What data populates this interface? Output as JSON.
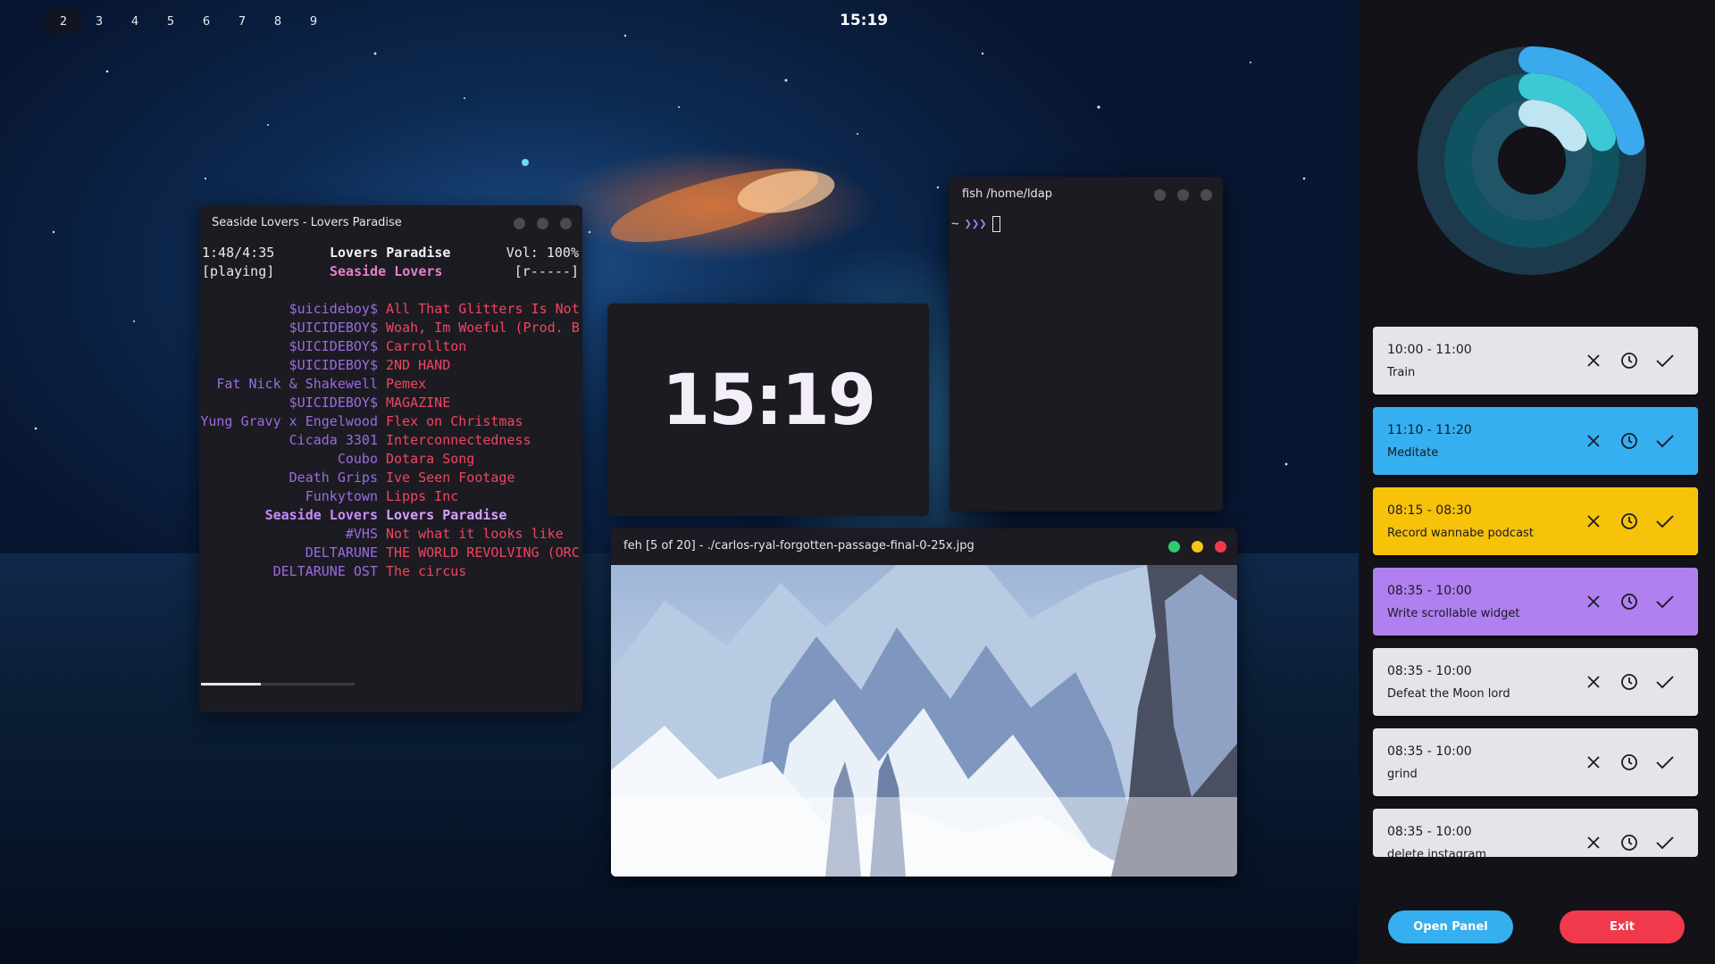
{
  "workspaces": [
    "2",
    "3",
    "4",
    "5",
    "6",
    "7",
    "8",
    "9"
  ],
  "top_clock": "15:19",
  "music_window": {
    "title": "Seaside Lovers - Lovers Paradise",
    "elapsed": "1:48/4:35",
    "status": "[playing]",
    "now_title": "Lovers Paradise",
    "now_artist": "Seaside Lovers",
    "volume": "Vol: 100%",
    "flags": "[r-----]",
    "progress": 0.39,
    "playlist": [
      {
        "artist": "$uicideboy$",
        "title": "All That Glitters Is Not"
      },
      {
        "artist": "$UICIDEBOY$",
        "title": "Woah, Im Woeful (Prod. B"
      },
      {
        "artist": "$UICIDEBOY$",
        "title": "Carrollton"
      },
      {
        "artist": "$UICIDEBOY$",
        "title": "2ND HAND"
      },
      {
        "artist": "Fat Nick & Shakewell",
        "title": "Pemex"
      },
      {
        "artist": "$UICIDEBOY$",
        "title": "MAGAZINE"
      },
      {
        "artist": "Yung Gravy x Engelwood",
        "title": "Flex on Christmas"
      },
      {
        "artist": "Cicada 3301",
        "title": "Interconnectedness"
      },
      {
        "artist": "Coubo",
        "title": "Dotara Song"
      },
      {
        "artist": "Death Grips",
        "title": "Ive Seen Footage"
      },
      {
        "artist": "Funkytown",
        "title": "Lipps Inc"
      },
      {
        "artist": "Seaside Lovers",
        "title": "Lovers Paradise",
        "current": true
      },
      {
        "artist": "#VHS",
        "title": "Not what it looks like"
      },
      {
        "artist": "DELTARUNE",
        "title": "THE WORLD REVOLVING (ORC"
      },
      {
        "artist": "DELTARUNE OST",
        "title": "The circus"
      }
    ]
  },
  "clock_widget": {
    "time": "15:19"
  },
  "terminal": {
    "title": "fish /home/ldap",
    "prompt_dir": "~",
    "prompt_symbol": "❯❯❯"
  },
  "image_viewer": {
    "title": "feh [5 of 20] - ./carlos-ryal-forgotten-passage-final-0-25x.jpg"
  },
  "sidebar": {
    "tasks": [
      {
        "time": "10:00 - 11:00",
        "name": "Train",
        "color": "#e4e4ea"
      },
      {
        "time": "11:10 - 11:20",
        "name": "Meditate",
        "color": "#35aff0"
      },
      {
        "time": "08:15 - 08:30",
        "name": "Record wannabe podcast",
        "color": "#f6c20a"
      },
      {
        "time": "08:35 - 10:00",
        "name": "Write scrollable widget",
        "color": "#b07ff0"
      },
      {
        "time": "08:35 - 10:00",
        "name": "Defeat the Moon lord",
        "color": "#e4e4ea"
      },
      {
        "time": "08:35 - 10:00",
        "name": "grind",
        "color": "#e4e4ea"
      },
      {
        "time": "08:35 - 10:00",
        "name": "delete instagram",
        "color": "#e4e4ea"
      }
    ],
    "open_panel_label": "Open Panel",
    "exit_label": "Exit",
    "rings": [
      {
        "track": "#1c3a4c",
        "fill": "#3aa9ee",
        "fraction": 0.22
      },
      {
        "track": "#0f5360",
        "fill": "#3cc9d4",
        "fraction": 0.2
      },
      {
        "track": "#1f5566",
        "fill": "#bfe4f2",
        "fraction": 0.17
      }
    ]
  }
}
